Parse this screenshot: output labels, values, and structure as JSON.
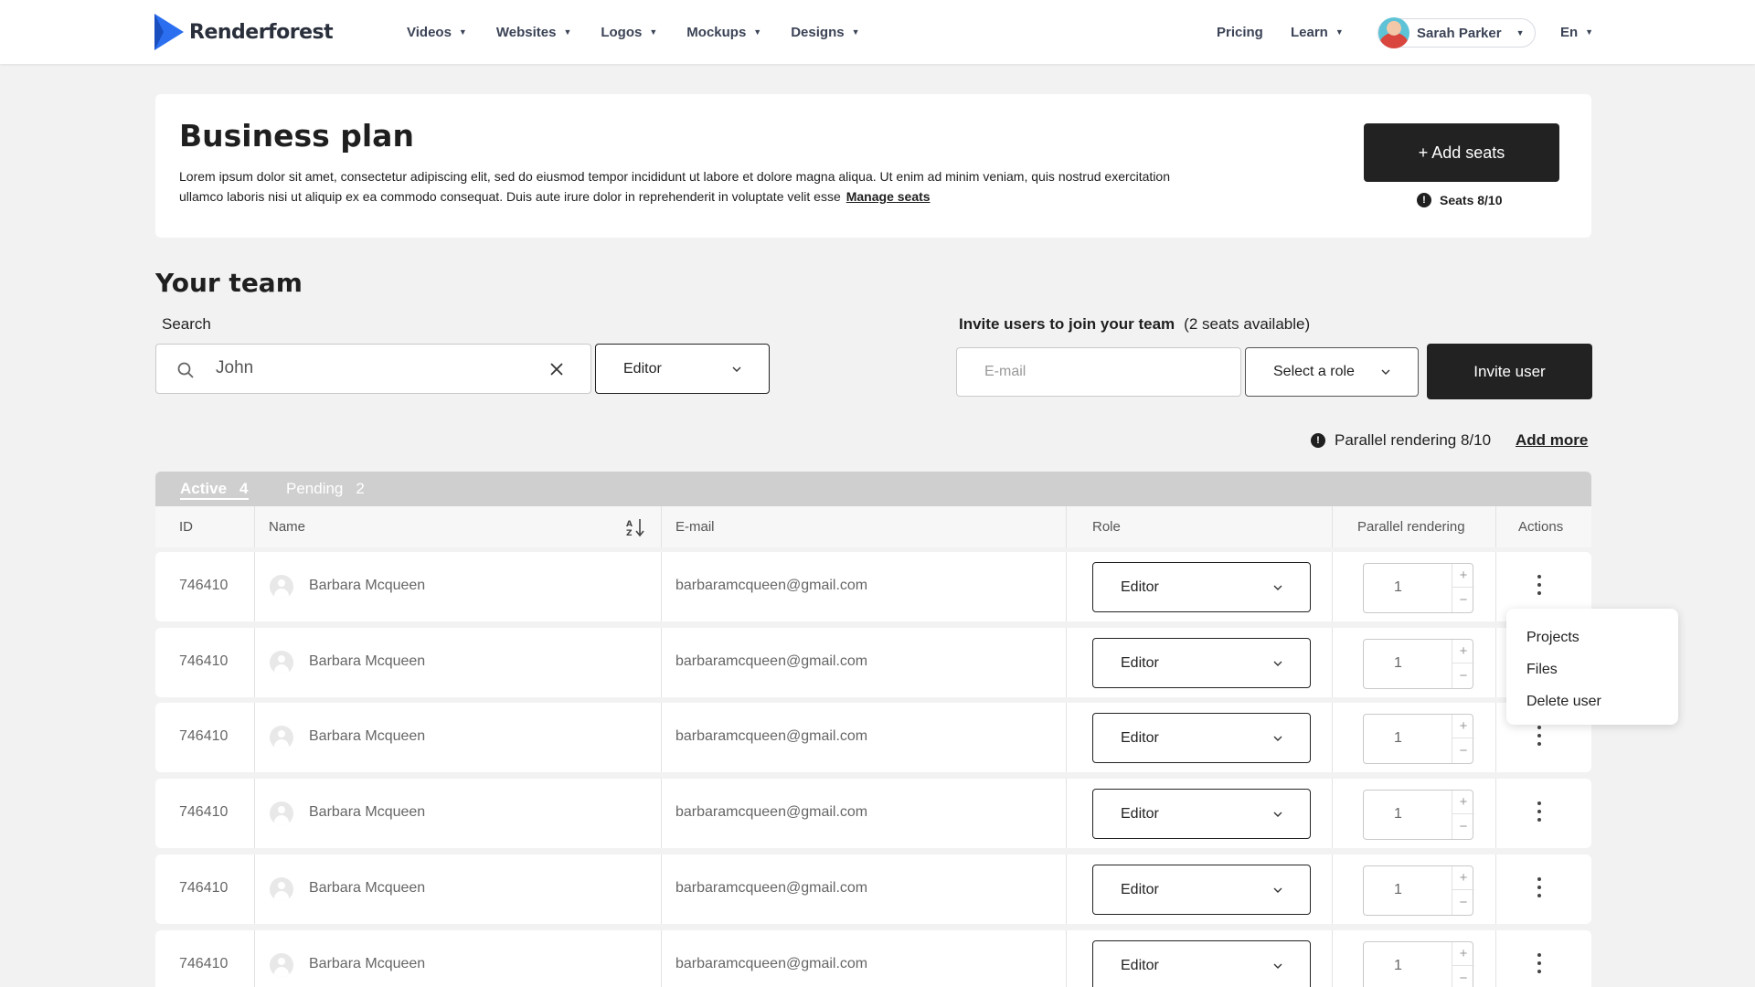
{
  "brand": {
    "name": "Renderforest",
    "color": "#2b6ff0"
  },
  "nav": {
    "items": [
      {
        "label": "Videos"
      },
      {
        "label": "Websites"
      },
      {
        "label": "Logos"
      },
      {
        "label": "Mockups"
      },
      {
        "label": "Designs"
      }
    ],
    "pricing": "Pricing",
    "learn": "Learn",
    "user_name": "Sarah Parker",
    "language": "En"
  },
  "plan": {
    "title": "Business plan",
    "description": "Lorem ipsum dolor sit amet, consectetur adipiscing elit, sed do eiusmod tempor incididunt ut labore et dolore magna aliqua. Ut enim ad minim veniam, quis nostrud exercitation ullamco laboris nisi ut aliquip ex ea commodo consequat. Duis aute irure dolor in reprehenderit in voluptate velit esse",
    "manage_link": "Manage seats",
    "add_seats_label": "+ Add seats",
    "seats_text": "Seats 8/10"
  },
  "team": {
    "title": "Your team",
    "search_label": "Search",
    "search_value": "John",
    "filter_role": "Editor",
    "invite_title": "Invite users to join your team",
    "invite_seats": "(2 seats available)",
    "email_placeholder": "E-mail",
    "role_placeholder": "Select a role",
    "invite_button": "Invite user",
    "parallel_text": "Parallel rendering 8/10",
    "add_more": "Add more"
  },
  "table": {
    "tabs": [
      {
        "label": "Active",
        "count": "4"
      },
      {
        "label": "Pending",
        "count": "2"
      }
    ],
    "headers": {
      "id": "ID",
      "name": "Name",
      "email": "E-mail",
      "role": "Role",
      "parallel": "Parallel rendering",
      "actions": "Actions"
    },
    "rows": [
      {
        "id": "746410",
        "name": "Barbara Mcqueen",
        "email": "barbaramcqueen@gmail.com",
        "role": "Editor",
        "parallel": "1"
      },
      {
        "id": "746410",
        "name": "Barbara Mcqueen",
        "email": "barbaramcqueen@gmail.com",
        "role": "Editor",
        "parallel": "1"
      },
      {
        "id": "746410",
        "name": "Barbara Mcqueen",
        "email": "barbaramcqueen@gmail.com",
        "role": "Editor",
        "parallel": "1"
      },
      {
        "id": "746410",
        "name": "Barbara Mcqueen",
        "email": "barbaramcqueen@gmail.com",
        "role": "Editor",
        "parallel": "1"
      },
      {
        "id": "746410",
        "name": "Barbara Mcqueen",
        "email": "barbaramcqueen@gmail.com",
        "role": "Editor",
        "parallel": "1"
      },
      {
        "id": "746410",
        "name": "Barbara Mcqueen",
        "email": "barbaramcqueen@gmail.com",
        "role": "Editor",
        "parallel": "1"
      }
    ],
    "action_menu": [
      "Projects",
      "Files",
      "Delete user"
    ]
  }
}
